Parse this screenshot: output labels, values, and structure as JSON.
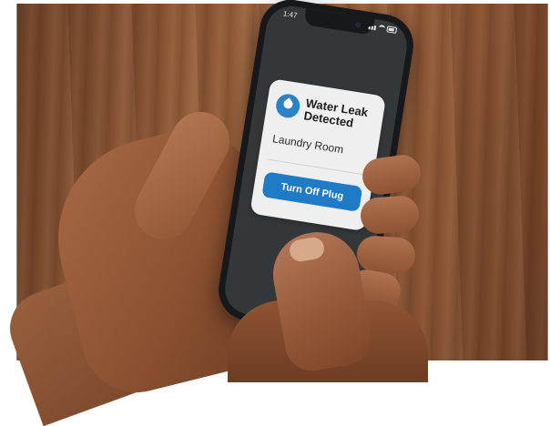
{
  "status_bar": {
    "time": "1:47"
  },
  "notification": {
    "icon": "water-drop-icon",
    "title": "Water Leak Detected",
    "subtitle": "Laundry Room",
    "action_label": "Turn Off Plug"
  },
  "colors": {
    "accent": "#1f7bc6",
    "card_background": "#efefef",
    "screen_background": "#34373a"
  }
}
